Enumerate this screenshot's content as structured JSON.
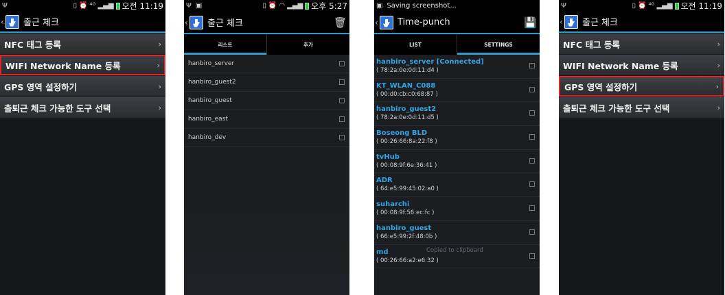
{
  "colors": {
    "accent": "#2d9ad2",
    "highlight": "#e0262b",
    "link": "#32a3e3"
  },
  "status": {
    "time_am": "오전 11:19",
    "time_pm": "오후 5:27",
    "saving_text": "Saving screenshot..."
  },
  "screen1": {
    "title": "출근 체크",
    "items": [
      {
        "label": "NFC 태그 등록"
      },
      {
        "label": "WIFI Network Name 등록"
      },
      {
        "label": "GPS 영역 설정하기"
      },
      {
        "label": "출퇴근 체크 가능한 도구 선택"
      }
    ]
  },
  "screen2": {
    "title": "출근 체크",
    "tabs": [
      "리스트",
      "추가"
    ],
    "list": [
      "hanbiro_server",
      "hanbiro_guest2",
      "hanbiro_guest",
      "hanbiro_east",
      "hanbiro_dev"
    ]
  },
  "screen3": {
    "title": "Time-punch",
    "tabs": [
      "LIST",
      "SETTINGS"
    ],
    "networks": [
      {
        "name": "hanbiro_server [Connected]",
        "mac": "( 78:2a:0e:0d:11:d4 )"
      },
      {
        "name": "KT_WLAN_C088",
        "mac": "( 00:d0:cb:c0:68:87 )"
      },
      {
        "name": "hanbiro_guest2",
        "mac": "( 78:2a:0e:0d:11:d5 )"
      },
      {
        "name": "Boseong BLD",
        "mac": "( 00:26:66:8a:22:f8 )"
      },
      {
        "name": "tvHub",
        "mac": "( 00:08:9f:6e:36:41 )"
      },
      {
        "name": "ADR",
        "mac": "( 64:e5:99:45:02:a0 )"
      },
      {
        "name": "suharchi",
        "mac": "( 00:08:9f:56:ec:fc )"
      },
      {
        "name": "hanbiro_guest",
        "mac": "( 66:e5:99:2f:48:0b )"
      },
      {
        "name": "md",
        "mac": "( 00:26:66:a2:e6:32 )"
      }
    ],
    "toast": "Copied to clipboard"
  },
  "screen4": {
    "title": "출근 체크",
    "items": [
      {
        "label": "NFC 태그 등록"
      },
      {
        "label": "WIFI Network Name 등록"
      },
      {
        "label": "GPS 영역 설정하기"
      },
      {
        "label": "출퇴근 체크 가능한 도구 선택"
      }
    ]
  }
}
